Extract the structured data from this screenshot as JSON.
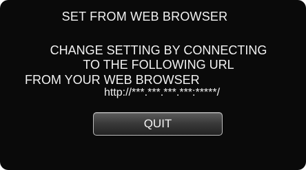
{
  "dialog": {
    "title": "SET FROM WEB BROWSER",
    "message_lines": [
      "CHANGE SETTING BY CONNECTING",
      "TO THE FOLLOWING URL",
      "FROM YOUR WEB BROWSER"
    ],
    "url": "http://***.***.***.***:*****/",
    "quit_label": "QUIT"
  },
  "colors": {
    "background": "#0a0a0a",
    "text": "#f2f2f2",
    "button_border": "#bdbdbd"
  }
}
